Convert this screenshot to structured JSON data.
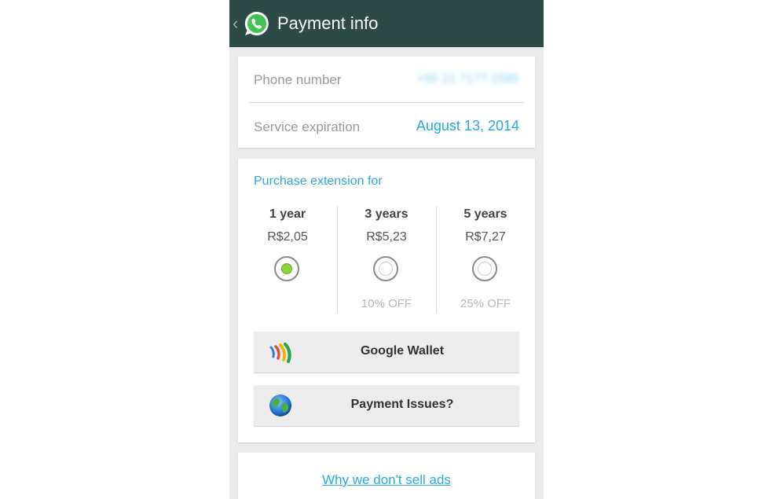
{
  "header": {
    "title": "Payment info",
    "back_glyph": "‹",
    "icons": [
      "chevron-left-icon",
      "whatsapp-logo-icon"
    ],
    "background_color": "#2d4a46"
  },
  "account": {
    "phone_label": "Phone number",
    "phone_value": "+55 21 7177-1585",
    "expiration_label": "Service expiration",
    "expiration_value": "August 13, 2014",
    "accent_color": "#29a8df"
  },
  "purchase": {
    "heading": "Purchase extension for",
    "plans": [
      {
        "name": "1 year",
        "price": "R$2,05",
        "discount": "",
        "selected": true
      },
      {
        "name": "3 years",
        "price": "R$5,23",
        "discount": "10% OFF",
        "selected": false
      },
      {
        "name": "5 years",
        "price": "R$7,27",
        "discount": "25% OFF",
        "selected": false
      }
    ],
    "selected_color": "#8fd33a"
  },
  "actions": {
    "wallet_label": "Google Wallet",
    "wallet_icon": "google-wallet-icon",
    "issues_label": "Payment Issues?",
    "issues_icon": "globe-icon"
  },
  "footer": {
    "ads_link": "Why we don't sell ads"
  }
}
